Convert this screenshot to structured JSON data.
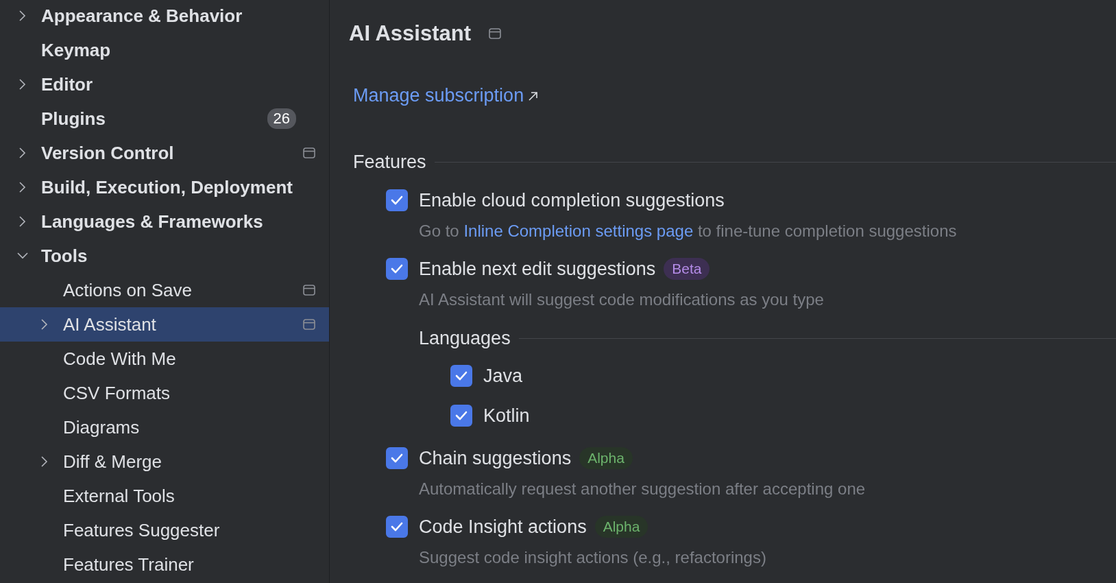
{
  "sidebar": {
    "items": [
      {
        "label": "Appearance & Behavior",
        "expanded": false,
        "selected": false,
        "project_level": false
      },
      {
        "label": "Keymap",
        "selected": false,
        "project_level": false
      },
      {
        "label": "Editor",
        "expanded": false,
        "selected": false,
        "project_level": false
      },
      {
        "label": "Plugins",
        "selected": false,
        "project_level": false,
        "badge": "26"
      },
      {
        "label": "Version Control",
        "expanded": false,
        "selected": false,
        "project_level": true
      },
      {
        "label": "Build, Execution, Deployment",
        "expanded": false,
        "selected": false,
        "project_level": false
      },
      {
        "label": "Languages & Frameworks",
        "expanded": false,
        "selected": false,
        "project_level": false
      },
      {
        "label": "Tools",
        "expanded": true,
        "selected": false,
        "project_level": false,
        "children": [
          {
            "label": "Actions on Save",
            "selected": false,
            "project_level": true
          },
          {
            "label": "AI Assistant",
            "expanded": false,
            "selected": true,
            "project_level": true
          },
          {
            "label": "Code With Me",
            "selected": false,
            "project_level": false
          },
          {
            "label": "CSV Formats",
            "selected": false,
            "project_level": false
          },
          {
            "label": "Diagrams",
            "selected": false,
            "project_level": false
          },
          {
            "label": "Diff & Merge",
            "expanded": false,
            "selected": false,
            "project_level": false
          },
          {
            "label": "External Tools",
            "selected": false,
            "project_level": false
          },
          {
            "label": "Features Suggester",
            "selected": false,
            "project_level": false
          },
          {
            "label": "Features Trainer",
            "selected": false,
            "project_level": false
          }
        ]
      }
    ]
  },
  "page": {
    "title": "AI Assistant",
    "project_level": true,
    "link": "Manage subscription"
  },
  "features": {
    "heading": "Features",
    "items": [
      {
        "kind": "checkbox",
        "label": "Enable cloud completion suggestions",
        "checked": true,
        "description": [
          {
            "kind": "text",
            "text": "Go to "
          },
          {
            "kind": "link",
            "text": "Inline Completion settings page"
          },
          {
            "kind": "text",
            "text": " to fine-tune completion suggestions"
          }
        ]
      },
      {
        "kind": "checkbox",
        "label": "Enable next edit suggestions",
        "checked": true,
        "tag": {
          "text": "Beta",
          "kind": "beta"
        },
        "description": [
          {
            "kind": "text",
            "text": "AI Assistant will suggest code modifications as you type"
          }
        ]
      },
      {
        "kind": "group",
        "heading": "Languages",
        "items": [
          {
            "kind": "checkbox",
            "label": "Java",
            "checked": true
          },
          {
            "kind": "checkbox",
            "label": "Kotlin",
            "checked": true
          }
        ]
      },
      {
        "kind": "checkbox",
        "label": "Chain suggestions",
        "checked": true,
        "tag": {
          "text": "Alpha",
          "kind": "alpha"
        },
        "description": [
          {
            "kind": "text",
            "text": "Automatically request another suggestion after accepting one"
          }
        ]
      },
      {
        "kind": "checkbox",
        "label": "Code Insight actions",
        "checked": true,
        "tag": {
          "text": "Alpha",
          "kind": "alpha"
        },
        "description": [
          {
            "kind": "text",
            "text": "Suggest code insight actions (e.g., refactorings)"
          }
        ]
      }
    ]
  }
}
